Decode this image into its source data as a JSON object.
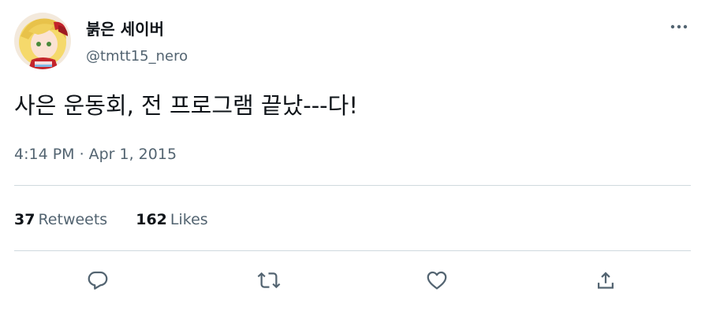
{
  "author": {
    "display_name": "붉은 세이버",
    "handle": "@tmtt15_nero"
  },
  "tweet": {
    "text": "사은 운동회, 전 프로그램 끝났---다!",
    "time": "4:14 PM",
    "date": "Apr 1, 2015",
    "separator": "·"
  },
  "stats": {
    "retweets_count": "37",
    "retweets_label": "Retweets",
    "likes_count": "162",
    "likes_label": "Likes"
  },
  "icons": {
    "more": "more-horizontal-icon",
    "reply": "reply-icon",
    "retweet": "retweet-icon",
    "like": "heart-icon",
    "share": "share-icon"
  },
  "colors": {
    "text_primary": "#0f1419",
    "text_secondary": "#536471",
    "divider": "#cfd9de"
  }
}
